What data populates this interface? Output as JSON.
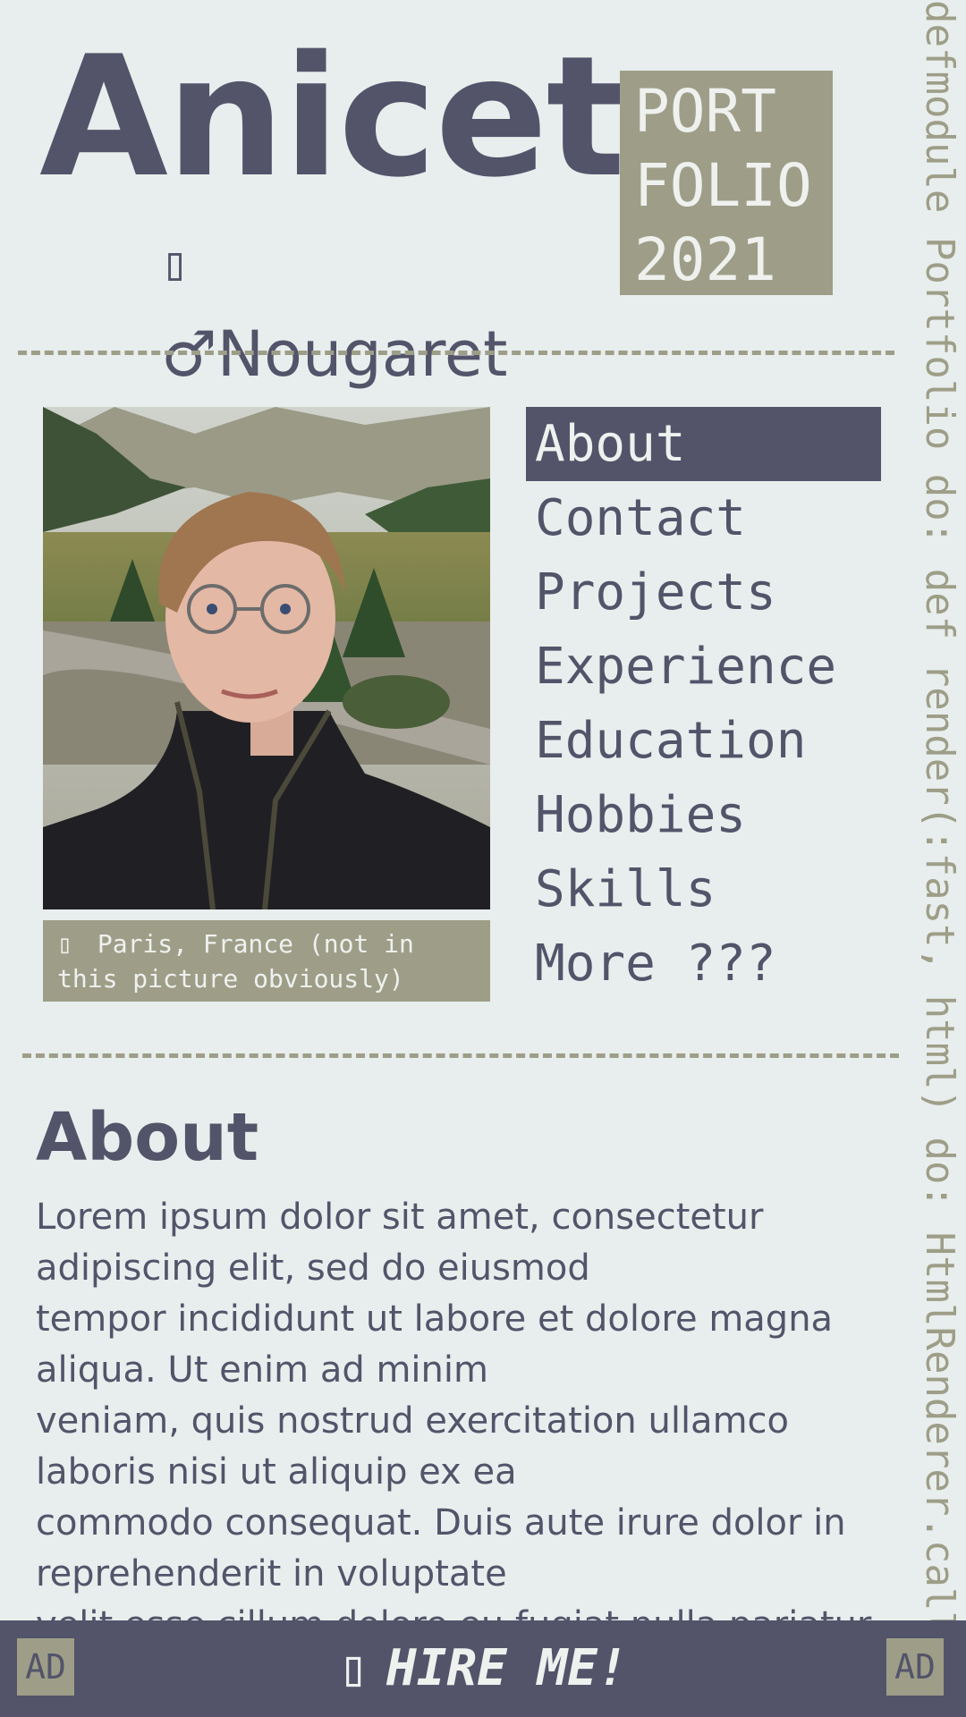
{
  "header": {
    "first_name": "Anicet",
    "name_glyph": "▯",
    "gender_symbol": "♂",
    "last_name": "Nougaret",
    "portfolio_lines": [
      "PORT",
      "FOLIO",
      "2021"
    ]
  },
  "vertical_code": "defmodule Portfolio do: def render(:fast, html) do: HtmlRenderer.call(:",
  "photo": {
    "caption_icon": "▯",
    "caption_text": "Paris, France (not in this picture obviously)"
  },
  "nav": {
    "items": [
      {
        "label": "About",
        "active": true
      },
      {
        "label": "Contact"
      },
      {
        "label": "Projects"
      },
      {
        "label": "Experience"
      },
      {
        "label": "Education"
      },
      {
        "label": "Hobbies"
      },
      {
        "label": "Skills"
      },
      {
        "label": "More ???"
      }
    ]
  },
  "about": {
    "heading": "About",
    "text": "Lorem ipsum dolor sit amet, consectetur adipiscing elit, sed do eiusmod\ntempor incididunt ut labore et dolore magna aliqua. Ut enim ad minim\nveniam, quis nostrud exercitation ullamco laboris nisi ut aliquip ex ea\ncommodo consequat. Duis aute irure dolor in reprehenderit in voluptate\nvelit esse cillum dolore eu fugiat nulla pariatur."
  },
  "bottom_bar": {
    "ad_left": "AD",
    "ad_right": "AD",
    "hire_icon": "▯",
    "hire_label": "HIRE ME!"
  },
  "colors": {
    "background": "#e8eeed",
    "primary": "#53546a",
    "accent": "#9e9e88",
    "light_text": "#eef1ee"
  }
}
